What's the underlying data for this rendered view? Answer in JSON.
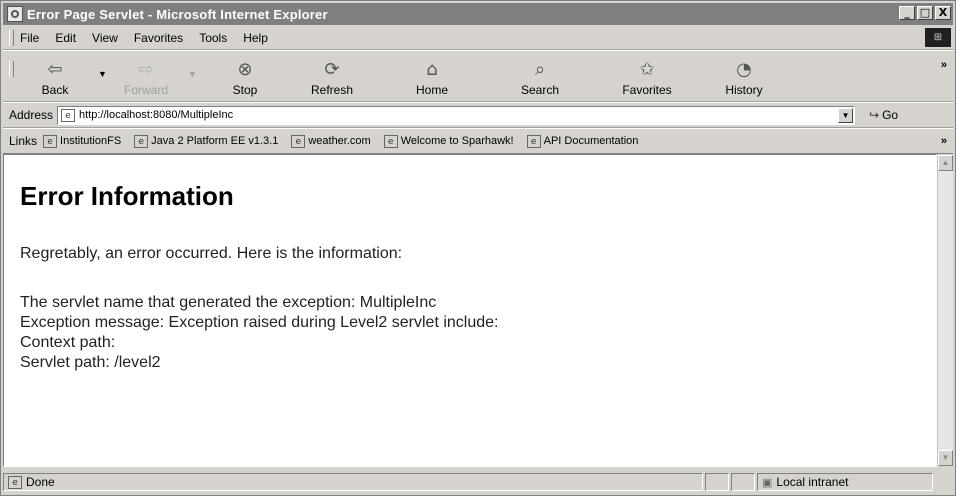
{
  "window": {
    "title": "Error Page Servlet - Microsoft Internet Explorer",
    "controls": {
      "minimize": "_",
      "maximize": "□",
      "close": "X"
    }
  },
  "menu": {
    "items": [
      {
        "label": "File",
        "accel": "F"
      },
      {
        "label": "Edit",
        "accel": "E"
      },
      {
        "label": "View",
        "accel": "V"
      },
      {
        "label": "Favorites",
        "accel": "a"
      },
      {
        "label": "Tools",
        "accel": "T"
      },
      {
        "label": "Help",
        "accel": "H"
      }
    ]
  },
  "toolbar": {
    "back": "Back",
    "forward": "Forward",
    "stop": "Stop",
    "refresh": "Refresh",
    "home": "Home",
    "search": "Search",
    "favorites": "Favorites",
    "history": "History",
    "more": "»"
  },
  "address": {
    "label": "Address",
    "value": "http://localhost:8080/MultipleInc",
    "go": "Go"
  },
  "links": {
    "label": "Links",
    "items": [
      "InstitutionFS",
      "Java 2 Platform EE v1.3.1",
      "weather.com",
      "Welcome to Sparhawk!",
      "API Documentation"
    ],
    "more": "»"
  },
  "page": {
    "heading": "Error Information",
    "intro": "Regretably, an error occurred. Here is the information:",
    "servlet_name": "The servlet name that generated the exception: MultipleInc",
    "exception_message": "Exception message: Exception raised during Level2 servlet include:",
    "context_path": "Context path:",
    "servlet_path": "Servlet path: /level2"
  },
  "status": {
    "text": "Done",
    "zone": "Local intranet"
  },
  "colors": {
    "chrome": "#d6d3ce",
    "titlebar": "#7f7f7f",
    "content_bg": "#ffffff"
  }
}
